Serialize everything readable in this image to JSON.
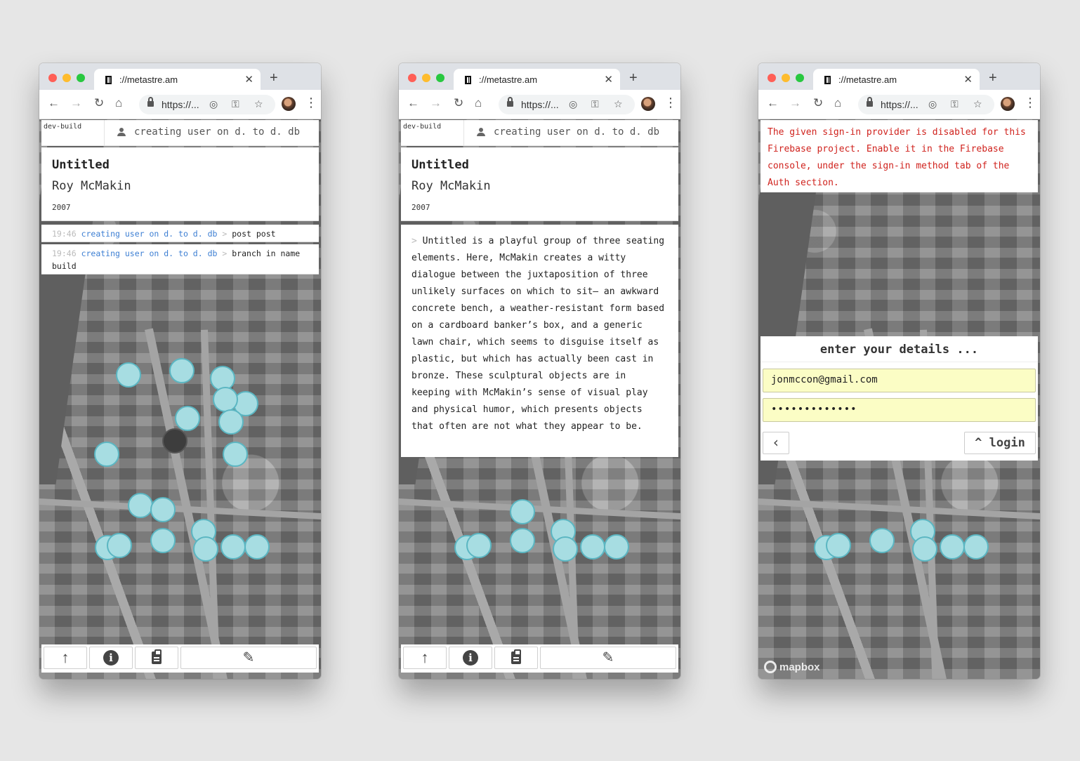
{
  "browser": {
    "tab_title": "://metastre.am",
    "tab_close": "✕",
    "new_tab": "+",
    "url": "https://...",
    "nav": {
      "back": "←",
      "forward": "→",
      "reload": "↻",
      "home": "⌂",
      "menu": "⋮"
    },
    "omni_icons": {
      "location": "◎",
      "key": "⚿",
      "star": "☆"
    }
  },
  "app": {
    "dev_label": "dev-build",
    "user_status": "creating user on d. to d. db",
    "artwork": {
      "title": "Untitled",
      "artist": "Roy McMakin",
      "year": "2007"
    },
    "log": [
      {
        "time": "19:46",
        "actor": "creating user on d. to d. db",
        "sep": ">",
        "action": "post post"
      },
      {
        "time": "19:46",
        "actor": "creating user on d. to d. db",
        "sep": ">",
        "action": "branch in name build"
      }
    ],
    "description": {
      "prefix": ">",
      "text": "Untitled is a playful group of three seating elements. Here, McMakin creates a witty dialogue between the juxtaposition of three unlikely surfaces on which to sit— an awkward concrete bench, a weather-resistant form based on a cardboard banker’s box, and a generic lawn chair, which seems to disguise itself as plastic, but which has actually been cast in bronze. These sculptural objects are in keeping with McMakin’s sense of visual play and physical humor, which presents objects that often are not what they appear to be."
    },
    "bottom_bar": {
      "up_icon": "arrow-up-icon",
      "info_icon": "info-icon",
      "clipboard_icon": "clipboard-icon",
      "edit_icon": "pencil-icon"
    },
    "error": "The given sign-in provider is disabled for this Firebase project. Enable it in the Firebase console, under the sign-in method tab of the Auth section.",
    "login": {
      "heading": "enter your details ...",
      "email": "jonmccon@gmail.com",
      "password": "•••••••••••••",
      "back_glyph": "‹",
      "login_label": "login",
      "login_glyph": "^"
    },
    "map_attribution": "mapbox"
  },
  "colors": {
    "background": "#e6e6e6",
    "marker_fill": "#a7dde2",
    "marker_stroke": "#5bb6c2",
    "marker_active": "#3d3d3d",
    "link": "#3d7fd3",
    "error": "#d0231e",
    "field_autofill": "#fbfdc5"
  }
}
